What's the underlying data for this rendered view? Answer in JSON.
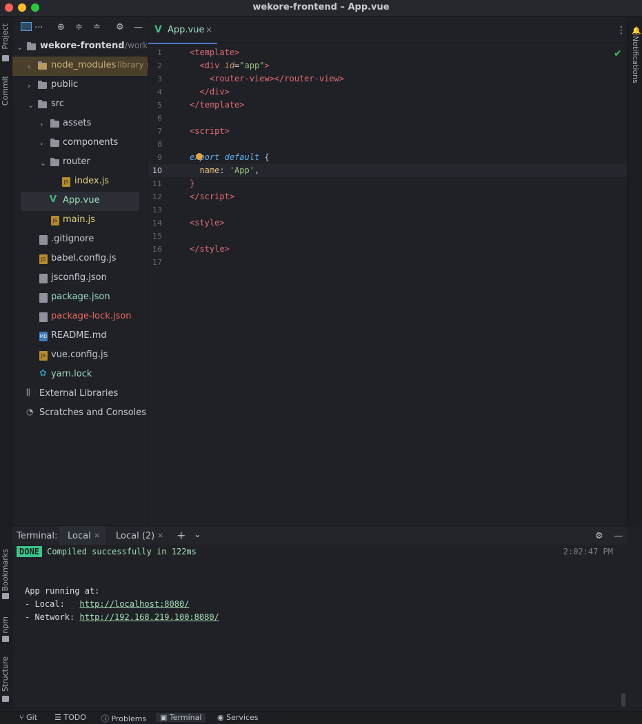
{
  "window": {
    "title": "wekore-frontend – App.vue"
  },
  "left_strip": {
    "project": "Project",
    "commit": "Commit",
    "bookmarks": "Bookmarks",
    "npm": "npm",
    "structure": "Structure"
  },
  "right_strip": {
    "notifications": "Notifications"
  },
  "project_toolbar": {
    "label": "..."
  },
  "tree": {
    "root": {
      "name": "wekore-frontend",
      "path": "~/work"
    },
    "node_modules": {
      "name": "node_modules",
      "hint": "library r"
    },
    "public": "public",
    "src": "src",
    "assets": "assets",
    "components": "components",
    "router": "router",
    "index_js": "index.js",
    "app_vue": "App.vue",
    "main_js": "main.js",
    "gitignore": ".gitignore",
    "babel": "babel.config.js",
    "jsconfig": "jsconfig.json",
    "package": "package.json",
    "package_lock": "package-lock.json",
    "readme": "README.md",
    "vue_config": "vue.config.js",
    "yarn": "yarn.lock",
    "external": "External Libraries",
    "scratches": "Scratches and Consoles"
  },
  "editor": {
    "tab": {
      "label": "App.vue",
      "close": "×"
    },
    "line_numbers": [
      "1",
      "2",
      "3",
      "4",
      "5",
      "6",
      "7",
      "8",
      "9",
      "10",
      "11",
      "12",
      "13",
      "14",
      "15",
      "16",
      "17"
    ],
    "current_line": "10"
  },
  "terminal": {
    "title": "Terminal:",
    "tabs": [
      "Local",
      "Local (2)"
    ],
    "done": "DONE",
    "compiled": "Compiled successfully in 122ms",
    "time": "2:02:47 PM",
    "running": "App running at:",
    "local_label": "- Local:   ",
    "local_url": "http://localhost:8080/",
    "network_label": "- Network: ",
    "network_url": "http://192.168.219.100:8080/"
  },
  "status_bar": {
    "git": "Git",
    "todo": "TODO",
    "problems": "Problems",
    "terminal": "Terminal",
    "services": "Services"
  }
}
